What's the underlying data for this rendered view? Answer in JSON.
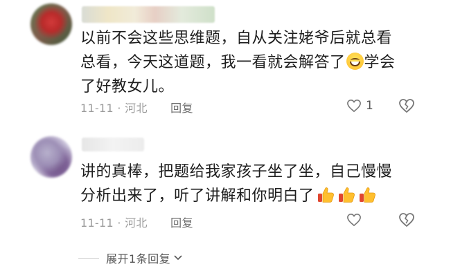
{
  "comments": [
    {
      "text_lines": [
        "以前不会这些思维题，自从关注姥爷后就总看",
        "总看，今天这道题，我一看就会解答了",
        "学会",
        "了好教女儿。"
      ],
      "date": "11-11",
      "location": "河北",
      "reply_label": "回复",
      "like_count": "1"
    },
    {
      "text_lines": [
        "讲的真棒，把题给我家孩子坐了坐，自己慢慢",
        "分析出来了，听了讲解和你明白了"
      ],
      "date": "11-11",
      "location": "河北",
      "reply_label": "回复",
      "like_count": ""
    }
  ],
  "emojis": {
    "comment1_inline": "grinning-face",
    "comment2_trailing": [
      "thumbs-up",
      "thumbs-up",
      "thumbs-up"
    ]
  },
  "expand_replies": {
    "label": "展开1条回复"
  },
  "colors": {
    "meta_text": "#9b9b9b",
    "body_text": "#1e1e1e",
    "emoji_yellow": "#ffc83a",
    "thumb_red": "#e0462f"
  }
}
